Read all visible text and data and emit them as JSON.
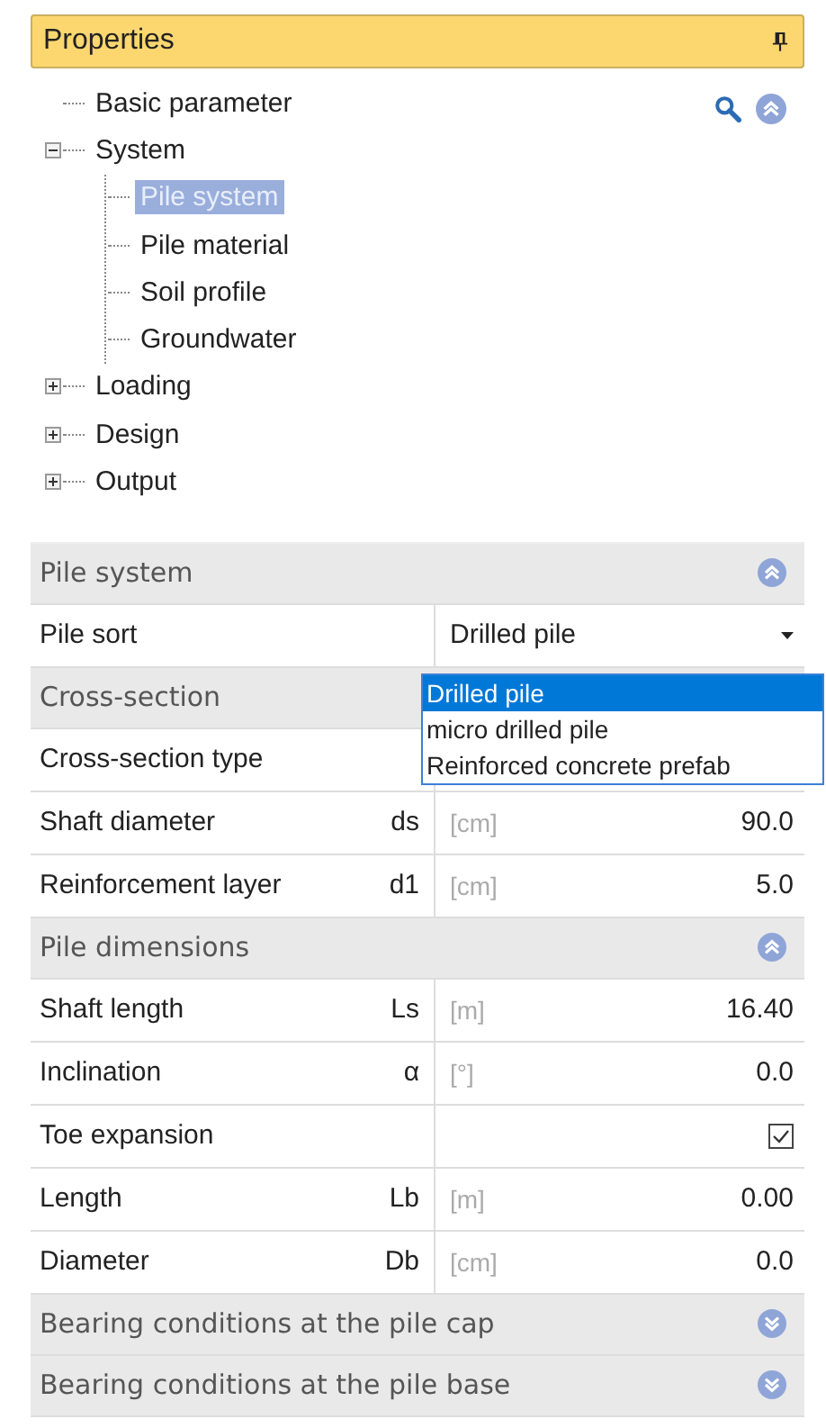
{
  "panel": {
    "title": "Properties",
    "pinned": true
  },
  "tree": [
    {
      "label": "Basic parameter",
      "selected": false
    },
    {
      "label": "System",
      "selected": false,
      "expanded": true,
      "children": [
        {
          "label": "Pile system",
          "selected": true
        },
        {
          "label": "Pile material",
          "selected": false
        },
        {
          "label": "Soil profile",
          "selected": false
        },
        {
          "label": "Groundwater",
          "selected": false
        }
      ]
    },
    {
      "label": "Loading",
      "selected": false,
      "expanded": false
    },
    {
      "label": "Design",
      "selected": false,
      "expanded": false
    },
    {
      "label": "Output",
      "selected": false,
      "expanded": false
    }
  ],
  "sections": [
    {
      "title": "Pile system",
      "expanded": true,
      "rows": [
        {
          "kind": "select",
          "label": "Pile sort",
          "value": "Drilled pile",
          "open": true,
          "options": [
            {
              "label": "Drilled pile",
              "selected": true
            },
            {
              "label": "micro drilled pile",
              "selected": false
            },
            {
              "label": "Reinforced concrete prefab",
              "selected": false
            }
          ]
        }
      ]
    },
    {
      "title": "Cross-section",
      "rows": [
        {
          "kind": "text",
          "label": "Cross-section type"
        },
        {
          "kind": "number",
          "label": "Shaft diameter",
          "symbol": "ds",
          "unit": "[cm]",
          "value": "90.0"
        },
        {
          "kind": "number",
          "label": "Reinforcement layer",
          "symbol": "d1",
          "unit": "[cm]",
          "value": "5.0"
        }
      ]
    },
    {
      "title": "Pile dimensions",
      "expanded": true,
      "rows": [
        {
          "kind": "number",
          "label": "Shaft length",
          "symbol": "Ls",
          "unit": "[m]",
          "value": "16.40"
        },
        {
          "kind": "number",
          "label": "Inclination",
          "symbol": "α",
          "unit": "[°]",
          "value": "0.0"
        },
        {
          "kind": "checkbox",
          "label": "Toe expansion",
          "checked": true
        },
        {
          "kind": "number",
          "label": "Length",
          "symbol": "Lb",
          "unit": "[m]",
          "value": "0.00"
        },
        {
          "kind": "number",
          "label": "Diameter",
          "symbol": "Db",
          "unit": "[cm]",
          "value": "0.0"
        }
      ]
    },
    {
      "title": "Bearing conditions at the pile cap",
      "expanded": false
    },
    {
      "title": "Bearing conditions at the pile base",
      "expanded": false
    }
  ]
}
